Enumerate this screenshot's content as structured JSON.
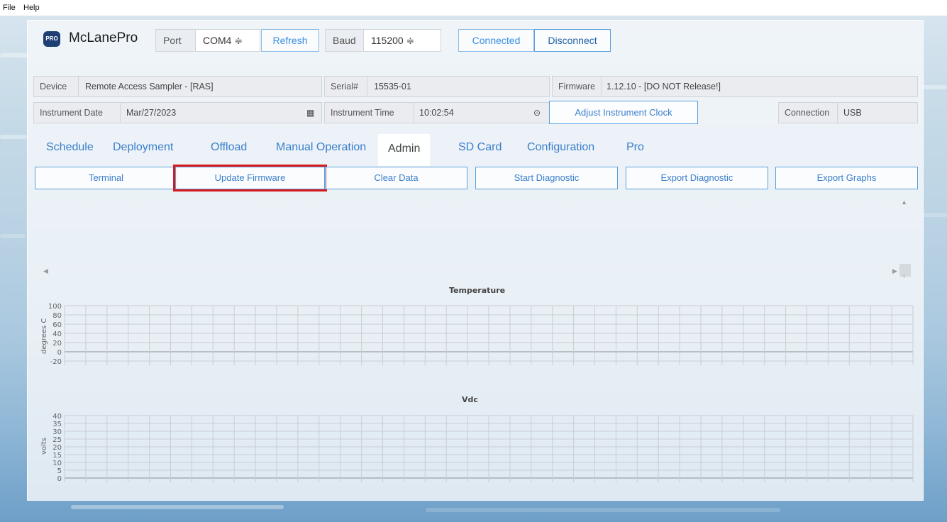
{
  "menu": [
    "File",
    "Help"
  ],
  "brand": {
    "logo_text": "PRO",
    "name": "McLanePro"
  },
  "toolbar": {
    "port_label": "Port",
    "port_value": "COM4 ≑",
    "refresh_label": "Refresh",
    "baud_label": "Baud",
    "baud_value": "115200 ≑",
    "connected_label": "Connected",
    "disconnect_label": "Disconnect"
  },
  "device": {
    "device_label": "Device",
    "device_value": "Remote Access Sampler - [RAS]",
    "serial_label": "Serial#",
    "serial_value": "15535-01",
    "firmware_label": "Firmware",
    "firmware_value": "1.12.10 - [DO NOT Release!]",
    "date_label": "Instrument Date",
    "date_value": "Mar/27/2023",
    "time_label": "Instrument Time",
    "time_value": "10:02:54",
    "adjust_clock_label": "Adjust Instrument Clock",
    "connection_label": "Connection",
    "connection_value": "USB"
  },
  "tabs": [
    "Schedule",
    "Deployment",
    "Offload",
    "Manual Operation",
    "Admin",
    "SD Card",
    "Configuration",
    "Pro"
  ],
  "active_tab": "Admin",
  "actions": [
    "Terminal",
    "Update Firmware",
    "Clear Data",
    "Start Diagnostic",
    "Export Diagnostic",
    "Export Graphs"
  ],
  "highlighted_action": "Update Firmware",
  "charts": [
    {
      "title": "Temperature",
      "ylabel": "degrees C",
      "yticks": [
        "100",
        "80",
        "60",
        "40",
        "20",
        "0",
        "-20"
      ]
    },
    {
      "title": "Vdc",
      "ylabel": "volts",
      "yticks": [
        "40",
        "35",
        "30",
        "25",
        "20",
        "15",
        "10",
        "5",
        "0"
      ]
    }
  ],
  "colors": {
    "accent": "#3a7fcc",
    "highlight": "#d8191c",
    "logo_bg": "#1d3f73"
  }
}
